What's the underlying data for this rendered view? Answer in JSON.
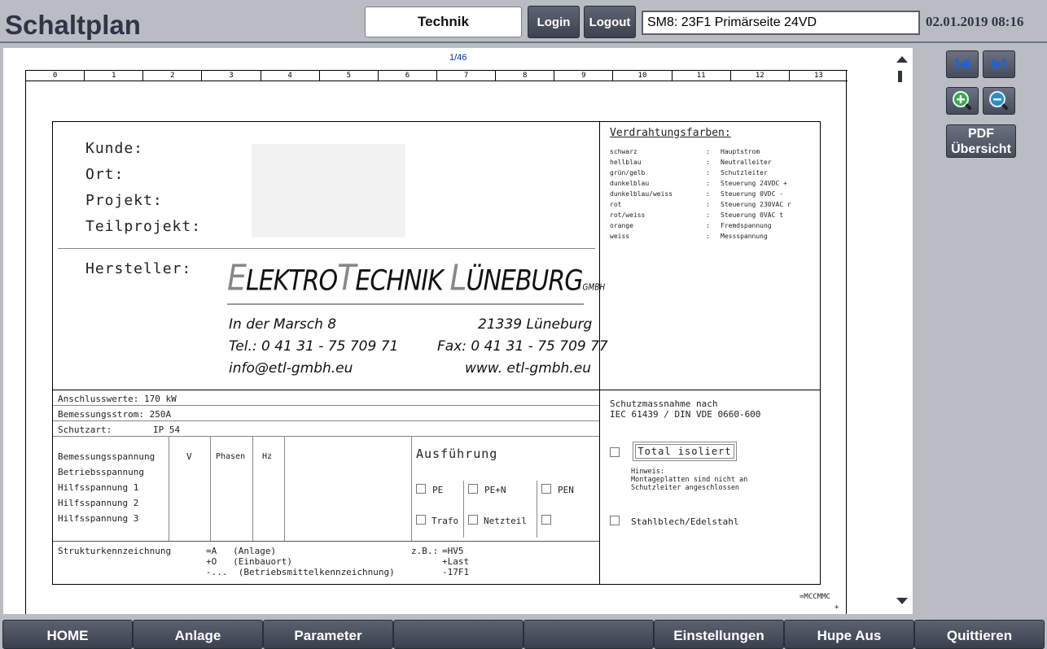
{
  "header": {
    "title": "Schaltplan",
    "user_level": "Technik",
    "login_label": "Login",
    "logout_label": "Logout",
    "file_name": "SM8: 23F1 Primärseite 24VD",
    "datetime": "02.01.2019 08:16"
  },
  "viewer": {
    "page_counter": "1/46",
    "ruler": [
      "0",
      "1",
      "2",
      "3",
      "4",
      "5",
      "6",
      "7",
      "8",
      "9",
      "10",
      "11",
      "12",
      "13"
    ],
    "sheet": {
      "labels": {
        "kunde": "Kunde:",
        "ort": "Ort:",
        "projekt": "Projekt:",
        "teilprojekt": "Teilprojekt:",
        "hersteller": "Hersteller:"
      },
      "logo": {
        "part1_cap": "E",
        "part1_rest": "LEKTRO",
        "part2_cap": "T",
        "part2_rest": "ECHNIK ",
        "part3_cap": "L",
        "part3_rest": "ÜNEBURG",
        "suffix": "GMBH"
      },
      "address": {
        "street": "In der Marsch 8",
        "city": "21339  Lüneburg",
        "tel": "Tel.: 0 41 31 - 75 709 71",
        "fax": "Fax: 0 41 31 - 75 709 77",
        "email": "info@etl-gmbh.eu",
        "web": "www. etl-gmbh.eu"
      },
      "wiring_title": "Verdrahtungsfarben:",
      "wiring": [
        {
          "color": "schwarz",
          "sep": ":",
          "use": "Hauptstrom"
        },
        {
          "color": "hellblau",
          "sep": ":",
          "use": "Neutralleiter"
        },
        {
          "color": "grün/gelb",
          "sep": ":",
          "use": "Schutzleiter"
        },
        {
          "color": "dunkelblau",
          "sep": ":",
          "use": "Steuerung 24VDC +"
        },
        {
          "color": "dunkelblau/weiss",
          "sep": ":",
          "use": "Steuerung 0VDC -"
        },
        {
          "color": "rot",
          "sep": ":",
          "use": "Steuerung 230VAC r"
        },
        {
          "color": "rot/weiss",
          "sep": ":",
          "use": "Steuerung 0VAC t"
        },
        {
          "color": "orange",
          "sep": ":",
          "use": "Fremdspannung"
        },
        {
          "color": "weiss",
          "sep": ":",
          "use": "Messspannung"
        }
      ],
      "anschlusswerte": "Anschlusswerte: 170 kW",
      "bemessungsstrom": "Bemessungsstrom: 250A",
      "schutzart_label": "Schutzart:",
      "schutzart_value": "IP 54",
      "voltage_rows": [
        "Bemessungsspannung",
        "Betriebsspannung",
        "Hilfsspannung 1",
        "Hilfsspannung 2",
        "Hilfsspannung 3"
      ],
      "col_v": "V",
      "col_phasen": "Phasen",
      "col_hz": "Hz",
      "ausfuehrung": "Ausführung",
      "opt_pe": "PE",
      "opt_pen_n": "PE+N",
      "opt_pen": "PEN",
      "opt_trafo": "Trafo",
      "opt_netzteil": "Netzteil",
      "schutz_line1": "Schutzmassnahme nach",
      "schutz_line2": "IEC 61439 / DIN VDE 0660-600",
      "total_isoliert": "Total isoliert",
      "hinweis1": "Hinweis:",
      "hinweis2": "Montageplatten sind nicht an",
      "hinweis3": "Schutzleiter angeschlossen",
      "stahlblech": "Stahlblech/Edelstahl",
      "struktur_label": "Strukturkennzeichnung",
      "struktur_lines": [
        "=A   (Anlage)",
        "+O   (Einbauort)",
        "-...  (Betriebsmittelkennzeichnung)"
      ],
      "zb_label": "z.B.:",
      "zb_lines": [
        "=HV5",
        "+Last",
        "-17F1"
      ],
      "corner_tag1": "=MCCMMC",
      "corner_tag2": "+"
    }
  },
  "side_panel": {
    "first_page_icon": "first-page-icon",
    "last_page_icon": "last-page-icon",
    "zoom_in_icon": "zoom-in-icon",
    "zoom_out_icon": "zoom-out-icon",
    "pdf_line1": "PDF",
    "pdf_line2": "Übersicht"
  },
  "footer": {
    "buttons": [
      "HOME",
      "Anlage",
      "Parameter",
      "",
      "",
      "Einstellungen",
      "Hupe Aus",
      "Quittieren"
    ]
  },
  "colors": {
    "background": "#b9bcc3",
    "button": "#474c5a",
    "title": "#2f3546",
    "zoom_in": "#3aa64a",
    "zoom_out": "#2f8dbf",
    "nav_arrow": "#1e63d6"
  }
}
